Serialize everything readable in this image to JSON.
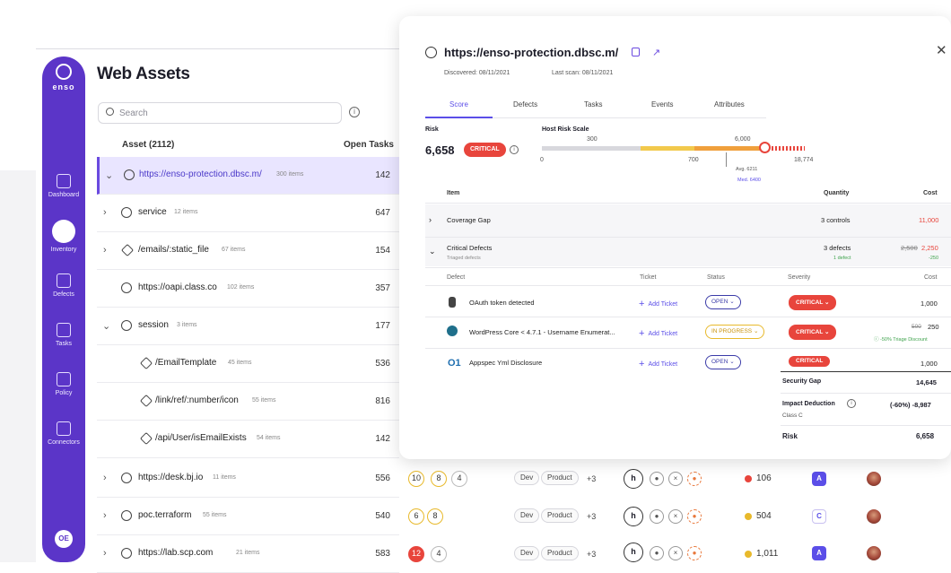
{
  "sidebar": {
    "brand": "enso",
    "items": [
      {
        "label": "Dashboard",
        "icon": "dashboard-icon"
      },
      {
        "label": "Inventory",
        "icon": "inventory-icon"
      },
      {
        "label": "Defects",
        "icon": "flag-icon"
      },
      {
        "label": "Tasks",
        "icon": "clipboard-icon"
      },
      {
        "label": "Policy",
        "icon": "policy-icon"
      },
      {
        "label": "Connectors",
        "icon": "connectors-icon"
      }
    ],
    "avatar_initials": "OE"
  },
  "page": {
    "title": "Web Assets",
    "search_placeholder": "Search",
    "col_asset": "Asset (2112)",
    "col_tasks": "Open Tasks"
  },
  "assets": [
    {
      "name": "https://enso-protection.dbsc.m/",
      "items": "300 items",
      "count": "142"
    },
    {
      "name": "service",
      "items": "12 items",
      "count": "647"
    },
    {
      "name": "/emails/:static_file",
      "items": "67 items",
      "count": "154"
    },
    {
      "name": "https://oapi.class.co",
      "items": "102 items",
      "count": "357"
    },
    {
      "name": "session",
      "items": "3 items",
      "count": "177"
    },
    {
      "name": "/EmailTemplate",
      "items": "45 items",
      "count": "536"
    },
    {
      "name": "/link/ref/:number/icon",
      "items": "55 items",
      "count": "816"
    },
    {
      "name": "/api/User/isEmailExists",
      "items": "54 items",
      "count": "142"
    },
    {
      "name": "https://desk.bj.io",
      "items": "11 items",
      "count": "556"
    },
    {
      "name": "poc.terraform",
      "items": "55 items",
      "count": "540"
    },
    {
      "name": "https://lab.scp.com",
      "items": "21 items",
      "count": "583"
    }
  ],
  "lower_rows": [
    {
      "rings": [
        "10",
        "8",
        "4"
      ],
      "tags": [
        "Dev",
        "Product"
      ],
      "more": "+3",
      "priority": "106",
      "grade": "A"
    },
    {
      "rings": [
        "6",
        "8"
      ],
      "tags": [
        "Dev",
        "Product"
      ],
      "more": "+3",
      "priority": "504",
      "grade": "C"
    },
    {
      "rings": [
        "12",
        "4"
      ],
      "tags": [
        "Dev",
        "Product"
      ],
      "more": "+3",
      "priority": "1,011",
      "grade": "A"
    }
  ],
  "panel": {
    "url": "https://enso-protection.dbsc.m/",
    "discovered": "Discovered: 08/11/2021",
    "last_scan": "Last scan: 08/11/2021",
    "tabs": [
      "Score",
      "Defects",
      "Tasks",
      "Events",
      "Attributes"
    ],
    "risk_label": "Risk",
    "risk_value": "6,658",
    "risk_badge": "CRITICAL",
    "scale_label": "Host Risk Scale",
    "scale_ticks": {
      "t300": "300",
      "t6000": "6,000",
      "t0": "0",
      "t700": "700",
      "t18774": "18,774"
    },
    "avg": "Avg. 6211",
    "med": "Med. 6400",
    "risk_fraction": 0.33,
    "table_headers": {
      "item": "Item",
      "quantity": "Quantity",
      "cost": "Cost"
    },
    "coverage": {
      "name": "Coverage Gap",
      "qty": "3 controls",
      "cost": "11,000"
    },
    "critical": {
      "name": "Critical Defects",
      "sub": "Triaged defects",
      "qty": "3 defects",
      "qty_sub": "1 defect",
      "old_cost": "2,500",
      "cost": "2,250",
      "delta": "-250"
    },
    "defect_headers": {
      "defect": "Defect",
      "ticket": "Ticket",
      "status": "Status",
      "severity": "Severity",
      "cost": "Cost"
    },
    "defects": [
      {
        "name": "OAuth token detected",
        "ticket": "Add Ticket",
        "status": "OPEN",
        "severity": "CRITICAL",
        "cost": "1,000"
      },
      {
        "name": "WordPress Core < 4.7.1 - Username Enumerat...",
        "ticket": "Add Ticket",
        "status": "IN PROGRESS",
        "severity": "CRITICAL",
        "old_cost": "500",
        "cost": "250",
        "note": "-50% Triage Discount"
      },
      {
        "name": "Appspec Yml Disclosure",
        "ticket": "Add Ticket",
        "status": "OPEN",
        "severity": "CRITICAL",
        "cost": "1,000"
      }
    ],
    "summary": {
      "security_gap_label": "Security Gap",
      "security_gap": "14,645",
      "impact_label": "Impact Deduction",
      "impact": "(-60%) -8,987",
      "class": "Class C",
      "risk_label": "Risk",
      "risk": "6,658"
    }
  },
  "colors": {
    "brand": "#5b35c8",
    "critical": "#e8453c",
    "accent": "#5b4ee8",
    "warning": "#e8b92b"
  }
}
